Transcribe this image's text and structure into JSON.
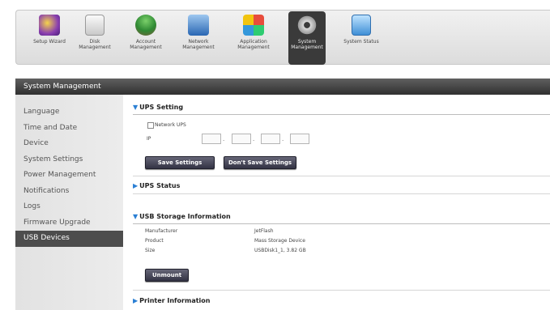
{
  "toolbar": {
    "items": [
      {
        "label": "Setup Wizard",
        "icon": "wizard-icon"
      },
      {
        "label": "Disk Management",
        "icon": "disk-icon"
      },
      {
        "label": "Account Management",
        "icon": "account-icon"
      },
      {
        "label": "Network Management",
        "icon": "network-icon"
      },
      {
        "label": "Application Management",
        "icon": "application-icon"
      },
      {
        "label": "System Management",
        "icon": "system-icon"
      },
      {
        "label": "System Status",
        "icon": "status-icon"
      }
    ],
    "active": "System Management"
  },
  "title": "System Management",
  "sidebar": {
    "items": [
      {
        "label": "Language"
      },
      {
        "label": "Time and Date"
      },
      {
        "label": "Device"
      },
      {
        "label": "System Settings"
      },
      {
        "label": "Power Management"
      },
      {
        "label": "Notifications"
      },
      {
        "label": "Logs"
      },
      {
        "label": "Firmware Upgrade"
      },
      {
        "label": "USB Devices"
      }
    ],
    "active": "USB Devices"
  },
  "ups_setting": {
    "heading": "UPS Setting",
    "network_ups_label": "Network UPS",
    "ip_label": "IP",
    "save_button": "Save Settings",
    "dont_save_button": "Don't Save Settings"
  },
  "ups_status": {
    "heading": "UPS Status"
  },
  "usb_storage": {
    "heading": "USB Storage Information",
    "rows": [
      {
        "label": "Manufacturer",
        "value": "JetFlash"
      },
      {
        "label": "Product",
        "value": "Mass Storage Device"
      },
      {
        "label": "Size",
        "value": "USBDisk1_1, 3.82 GB"
      }
    ],
    "unmount_button": "Unmount"
  },
  "printer": {
    "heading": "Printer Information"
  },
  "colors": {
    "accent": "#2a7fd4",
    "titlebar": "#404040",
    "active_sidebar": "#4d4d4d"
  }
}
